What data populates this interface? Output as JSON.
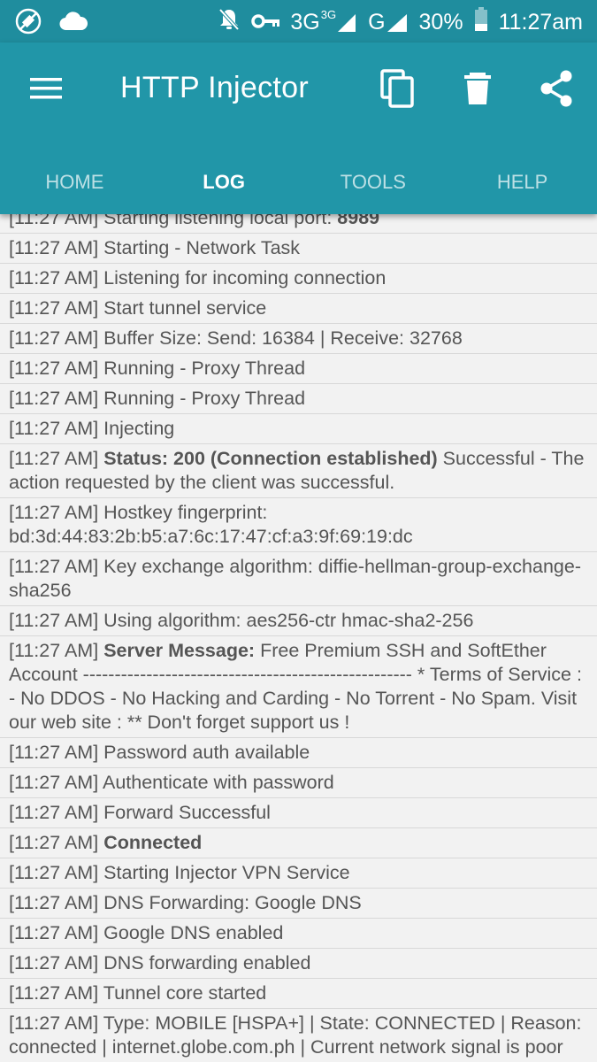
{
  "status_bar": {
    "network_type": "3G",
    "network_sup": "3G",
    "network_type_2": "G",
    "battery": "30%",
    "time": "11:27am"
  },
  "app_bar": {
    "title": "HTTP Injector",
    "icons": [
      "menu-icon",
      "copy-icon",
      "delete-icon",
      "share-icon"
    ]
  },
  "tabs": [
    {
      "label": "HOME",
      "active": false
    },
    {
      "label": "LOG",
      "active": true
    },
    {
      "label": "TOOLS",
      "active": false
    },
    {
      "label": "HELP",
      "active": false
    }
  ],
  "log": [
    {
      "time": "[11:27 AM]",
      "parts": [
        {
          "t": " Starting listening local port: "
        },
        {
          "t": "8989",
          "b": true
        }
      ]
    },
    {
      "time": "[11:27 AM]",
      "parts": [
        {
          "t": " Starting - Network Task"
        }
      ]
    },
    {
      "time": "[11:27 AM]",
      "parts": [
        {
          "t": " Listening for incoming connection"
        }
      ]
    },
    {
      "time": "[11:27 AM]",
      "parts": [
        {
          "t": " Start tunnel service"
        }
      ]
    },
    {
      "time": "[11:27 AM]",
      "parts": [
        {
          "t": " Buffer Size: Send: 16384 | Receive: 32768"
        }
      ]
    },
    {
      "time": "[11:27 AM]",
      "parts": [
        {
          "t": " Running - Proxy Thread"
        }
      ]
    },
    {
      "time": "[11:27 AM]",
      "parts": [
        {
          "t": " Running - Proxy Thread"
        }
      ]
    },
    {
      "time": "[11:27 AM]",
      "parts": [
        {
          "t": " Injecting"
        }
      ]
    },
    {
      "time": "[11:27 AM]",
      "parts": [
        {
          "t": " "
        },
        {
          "t": "Status: 200 (Connection established)",
          "b": true
        },
        {
          "t": " Successful - The action requested by the client was successful."
        }
      ]
    },
    {
      "time": "[11:27 AM]",
      "parts": [
        {
          "t": " Hostkey fingerprint: bd:3d:44:83:2b:b5:a7:6c:17:47:cf:a3:9f:69:19:dc"
        }
      ]
    },
    {
      "time": "[11:27 AM]",
      "parts": [
        {
          "t": " Key exchange algorithm: diffie-hellman-group-exchange-sha256"
        }
      ]
    },
    {
      "time": "[11:27 AM]",
      "parts": [
        {
          "t": " Using algorithm: aes256-ctr hmac-sha2-256"
        }
      ]
    },
    {
      "time": "[11:27 AM]",
      "parts": [
        {
          "t": " "
        },
        {
          "t": "Server Message:",
          "b": true
        },
        {
          "t": " Free Premium SSH and SoftEther Account ---------------------------------------------------- * Terms of Service : - No DDOS - No Hacking and Carding - No Torrent - No Spam. Visit our web site : ** Don't forget support us !"
        }
      ]
    },
    {
      "time": "[11:27 AM]",
      "parts": [
        {
          "t": " Password auth available"
        }
      ]
    },
    {
      "time": "[11:27 AM]",
      "parts": [
        {
          "t": " Authenticate with password"
        }
      ]
    },
    {
      "time": "[11:27 AM]",
      "parts": [
        {
          "t": " Forward Successful"
        }
      ]
    },
    {
      "time": "[11:27 AM]",
      "parts": [
        {
          "t": " "
        },
        {
          "t": "Connected",
          "b": true
        }
      ]
    },
    {
      "time": "[11:27 AM]",
      "parts": [
        {
          "t": " Starting Injector VPN Service"
        }
      ]
    },
    {
      "time": "[11:27 AM]",
      "parts": [
        {
          "t": " DNS Forwarding: Google DNS"
        }
      ]
    },
    {
      "time": "[11:27 AM]",
      "parts": [
        {
          "t": " Google DNS enabled"
        }
      ]
    },
    {
      "time": "[11:27 AM]",
      "parts": [
        {
          "t": " DNS forwarding enabled"
        }
      ]
    },
    {
      "time": "[11:27 AM]",
      "parts": [
        {
          "t": " Tunnel core started"
        }
      ]
    },
    {
      "time": "[11:27 AM]",
      "parts": [
        {
          "t": " Type: MOBILE [HSPA+] | State: CONNECTED | Reason: connected | internet.globe.com.ph | Current network signal is poor"
        }
      ]
    }
  ],
  "colors": {
    "status_bar": "#1f8d9e",
    "app_bar": "#2196a8",
    "background": "#f2f2f2",
    "text": "#555555"
  }
}
